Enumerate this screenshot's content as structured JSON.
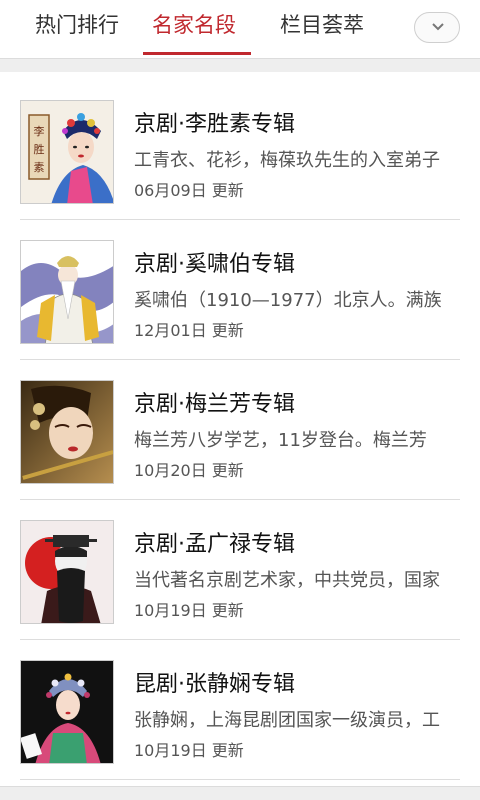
{
  "tabs": [
    {
      "label": "热门排行",
      "active": false
    },
    {
      "label": "名家名段",
      "active": true
    },
    {
      "label": "栏目荟萃",
      "active": false
    }
  ],
  "dropdown_icon": "chevron-down-icon",
  "accent_color": "#c0282e",
  "items": [
    {
      "title": "京剧·李胜素专辑",
      "desc": "工青衣、花衫，梅葆玖先生的入室弟子",
      "date": "06月09日 更新",
      "thumb_text": "李胜素"
    },
    {
      "title": "京剧·奚啸伯专辑",
      "desc": "奚啸伯（1910—1977）北京人。满族",
      "date": "12月01日 更新"
    },
    {
      "title": "京剧·梅兰芳专辑",
      "desc": "梅兰芳八岁学艺，11岁登台。梅兰芳",
      "date": "10月20日 更新"
    },
    {
      "title": "京剧·孟广禄专辑",
      "desc": "当代著名京剧艺术家，中共党员，国家",
      "date": "10月19日 更新"
    },
    {
      "title": "昆剧·张静娴专辑",
      "desc": "张静娴，上海昆剧团国家一级演员，工",
      "date": "10月19日 更新"
    }
  ]
}
